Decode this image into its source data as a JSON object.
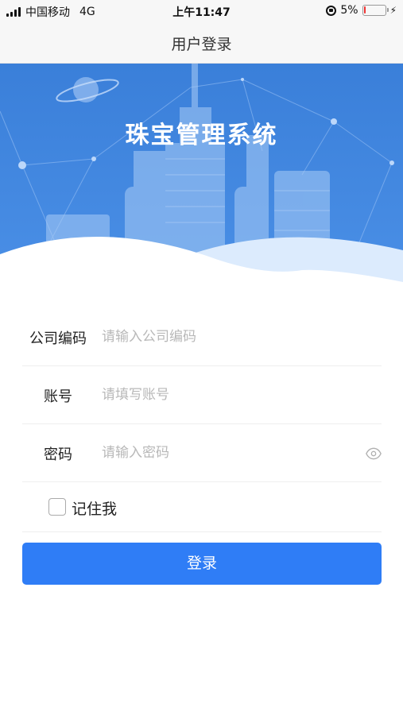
{
  "status_bar": {
    "carrier": "中国移动",
    "network": "4G",
    "time": "上午11:47",
    "battery": "5%",
    "battery_level": 0.05
  },
  "nav": {
    "title": "用户登录"
  },
  "banner": {
    "title": "珠宝管理系统"
  },
  "form": {
    "company_code": {
      "label": "公司编码",
      "placeholder": "请输入公司编码",
      "value": ""
    },
    "account": {
      "label": "账号",
      "placeholder": "请填写账号",
      "value": ""
    },
    "password": {
      "label": "密码",
      "placeholder": "请输入密码",
      "value": ""
    },
    "remember": {
      "label": "记住我",
      "checked": false
    }
  },
  "login_button": {
    "label": "登录"
  },
  "colors": {
    "primary": "#2f7df6",
    "banner_top": "#3a7fd9",
    "banner_bottom": "#4a8fe6",
    "placeholder": "#b8b8b8"
  },
  "icons": [
    "signal-icon",
    "lock-rotation-icon",
    "battery-icon",
    "charging-bolt-icon",
    "eye-icon",
    "planet-icon"
  ]
}
